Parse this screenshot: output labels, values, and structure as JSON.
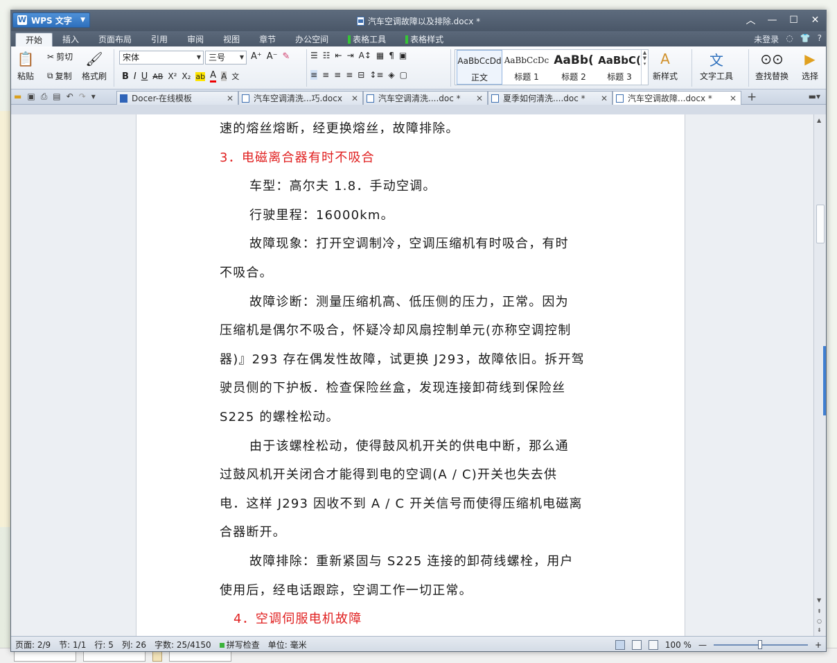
{
  "app": {
    "name": "WPS 文字",
    "window_title": "汽车空调故障以及排除.docx *"
  },
  "menu": {
    "tabs": [
      "开始",
      "插入",
      "页面布局",
      "引用",
      "审阅",
      "视图",
      "章节",
      "办公空间"
    ],
    "context_tabs": [
      "表格工具",
      "表格样式"
    ],
    "login": "未登录",
    "help": "?"
  },
  "ribbon": {
    "paste": "粘贴",
    "cut": "剪切",
    "copy": "复制",
    "format_painter": "格式刷",
    "font_name": "宋体",
    "font_size": "三号",
    "styles": [
      {
        "preview": "AaBbCcDd",
        "label": "正文"
      },
      {
        "preview": "AaBbCcDc",
        "label": "标题 1"
      },
      {
        "preview": "AaBb(",
        "label": "标题 2"
      },
      {
        "preview": "AaBbC(",
        "label": "标题 3"
      }
    ],
    "new_style": "新样式",
    "text_tools": "文字工具",
    "find_replace": "查找替换",
    "select": "选择"
  },
  "doc_tabs": [
    {
      "title": "Docer-在线模板",
      "active": false
    },
    {
      "title": "汽车空调清洗...巧.docx",
      "active": false
    },
    {
      "title": "汽车空调清洗....doc *",
      "active": false
    },
    {
      "title": "夏季如何清洗....doc *",
      "active": false
    },
    {
      "title": "汽车空调故障...docx *",
      "active": true
    }
  ],
  "document": {
    "lines": [
      {
        "text": "速的熔丝熔断，经更换熔丝，故障排除。",
        "style": "normal"
      },
      {
        "text": "3．电磁离合器有时不吸合",
        "style": "heading"
      },
      {
        "text": "车型：高尔夫 1.8．手动空调。",
        "style": "indent"
      },
      {
        "text": "行驶里程：16000km。",
        "style": "indent"
      },
      {
        "text": "故障现象：打开空调制冷，空调压缩机有时吸合，有时",
        "style": "indent"
      },
      {
        "text": "不吸合。",
        "style": "normal"
      },
      {
        "text": "故障诊断：测量压缩机高、低压侧的压力，正常。因为",
        "style": "indent"
      },
      {
        "text": "压缩机是偶尔不吸合，怀疑冷却风扇控制单元(亦称空调控制",
        "style": "normal"
      },
      {
        "text": "器)』293 存在偶发性故障，试更换 J293，故障依旧。拆开驾",
        "style": "normal"
      },
      {
        "text": "驶员侧的下护板．检查保险丝盒，发现连接卸荷线到保险丝",
        "style": "normal"
      },
      {
        "text": "S225 的螺栓松动。",
        "style": "normal"
      },
      {
        "text": "由于该螺栓松动，使得鼓风机开关的供电中断，那么通",
        "style": "indent"
      },
      {
        "text": "过鼓风机开关闭合才能得到电的空调(A / C)开关也失去供",
        "style": "normal"
      },
      {
        "text": "电．这样 J293 因收不到 A / C 开关信号而使得压缩机电磁离",
        "style": "normal"
      },
      {
        "text": "合器断开。",
        "style": "normal"
      },
      {
        "text": "故障排除：重新紧固与 S225 连接的卸荷线螺栓，用户",
        "style": "indent"
      },
      {
        "text": "使用后，经电话跟踪，空调工作一切正常。",
        "style": "normal"
      },
      {
        "text": "4．空调伺服电机故障",
        "style": "heading4"
      }
    ]
  },
  "status": {
    "page": "页面: 2/9",
    "section": "节: 1/1",
    "row": "行: 5",
    "col": "列: 26",
    "words": "字数: 25/4150",
    "spell": "拼写检查",
    "unit": "单位: 毫米",
    "zoom": "100 %"
  },
  "colors": {
    "heading_red": "#e02020",
    "wps_blue": "#2e70bd"
  }
}
